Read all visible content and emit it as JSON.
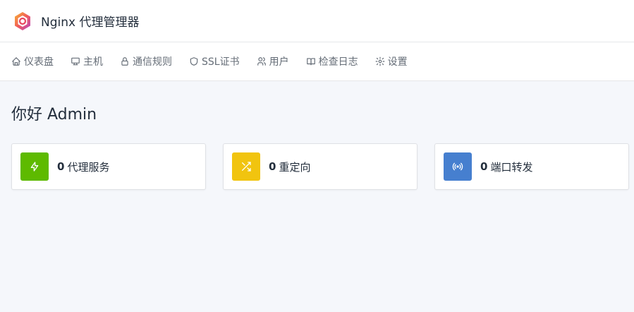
{
  "header": {
    "title": "Nginx 代理管理器",
    "logo_icon": "nginx-proxy-manager-logo"
  },
  "nav": {
    "items": [
      {
        "label": "仪表盘",
        "icon": "home-icon"
      },
      {
        "label": "主机",
        "icon": "monitor-icon"
      },
      {
        "label": "通信规则",
        "icon": "lock-icon"
      },
      {
        "label": "SSL证书",
        "icon": "shield-icon"
      },
      {
        "label": "用户",
        "icon": "users-icon"
      },
      {
        "label": "检查日志",
        "icon": "book-icon"
      },
      {
        "label": "设置",
        "icon": "gear-icon"
      }
    ]
  },
  "main": {
    "greeting": "你好 Admin",
    "cards": [
      {
        "count": "0",
        "label": "代理服务",
        "icon": "lightning-icon",
        "color": "#5eba00"
      },
      {
        "count": "0",
        "label": "重定向",
        "icon": "shuffle-icon",
        "color": "#f1c40f"
      },
      {
        "count": "0",
        "label": "端口转发",
        "icon": "radio-icon",
        "color": "#467fcf"
      }
    ]
  }
}
